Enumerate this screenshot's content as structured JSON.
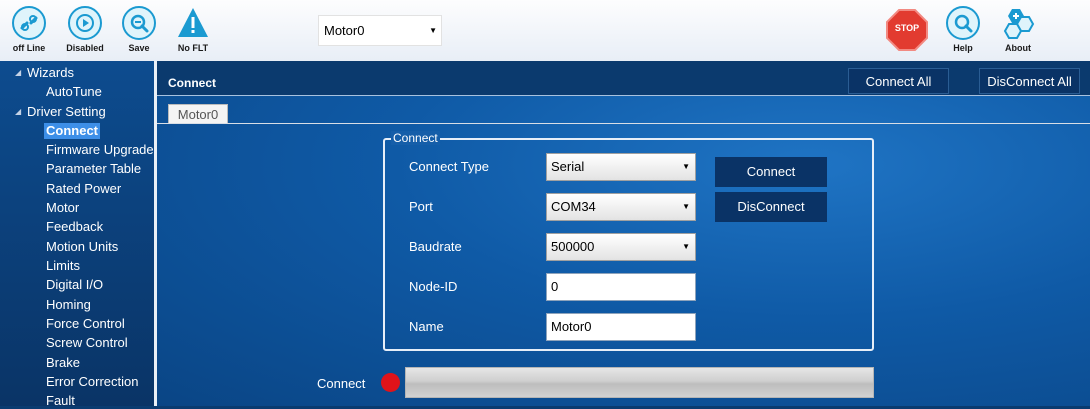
{
  "toolbar": {
    "offline_label": "off Line",
    "disabled_label": "Disabled",
    "save_label": "Save",
    "noflt_label": "No FLT",
    "motor_select": "Motor0",
    "stop_label": "STOP",
    "help_label": "Help",
    "about_label": "About",
    "icons": [
      "link-icon",
      "play-disabled-icon",
      "save-icon",
      "warning-icon",
      "stop-icon",
      "help-icon",
      "about-icon"
    ]
  },
  "sidebar": {
    "groups": [
      {
        "label": "Wizards",
        "items": [
          "AutoTune"
        ]
      },
      {
        "label": "Driver Setting",
        "items": [
          "Connect",
          "Firmware Upgrade",
          "Parameter Table",
          "Rated Power",
          "Motor",
          "Feedback",
          "Motion Units",
          "Limits",
          "Digital I/O",
          "Homing",
          "Force Control",
          "Screw Control",
          "Brake",
          "Error Correction",
          "Fault"
        ]
      }
    ],
    "selected": "Connect"
  },
  "header": {
    "title": "Connect",
    "connect_all": "Connect All",
    "disconnect_all": "DisConnect All"
  },
  "tab": {
    "label": "Motor0"
  },
  "connect_group": {
    "legend": "Connect",
    "connect_type_label": "Connect Type",
    "connect_type_value": "Serial",
    "port_label": "Port",
    "port_value": "COM34",
    "baudrate_label": "Baudrate",
    "baudrate_value": "500000",
    "node_id_label": "Node-ID",
    "node_id_value": "0",
    "name_label": "Name",
    "name_value": "Motor0",
    "connect_button": "Connect",
    "disconnect_button": "DisConnect"
  },
  "status": {
    "label": "Connect",
    "led_color": "#e0131a"
  },
  "colors": {
    "toolbar_bg": "#f4f7fb",
    "sidebar_bg": "#0d4c8f",
    "main_bg": "#1565b5",
    "button_bg": "#0a3366",
    "selected_bg": "#3d8fe8",
    "stop_red": "#e23b30"
  }
}
